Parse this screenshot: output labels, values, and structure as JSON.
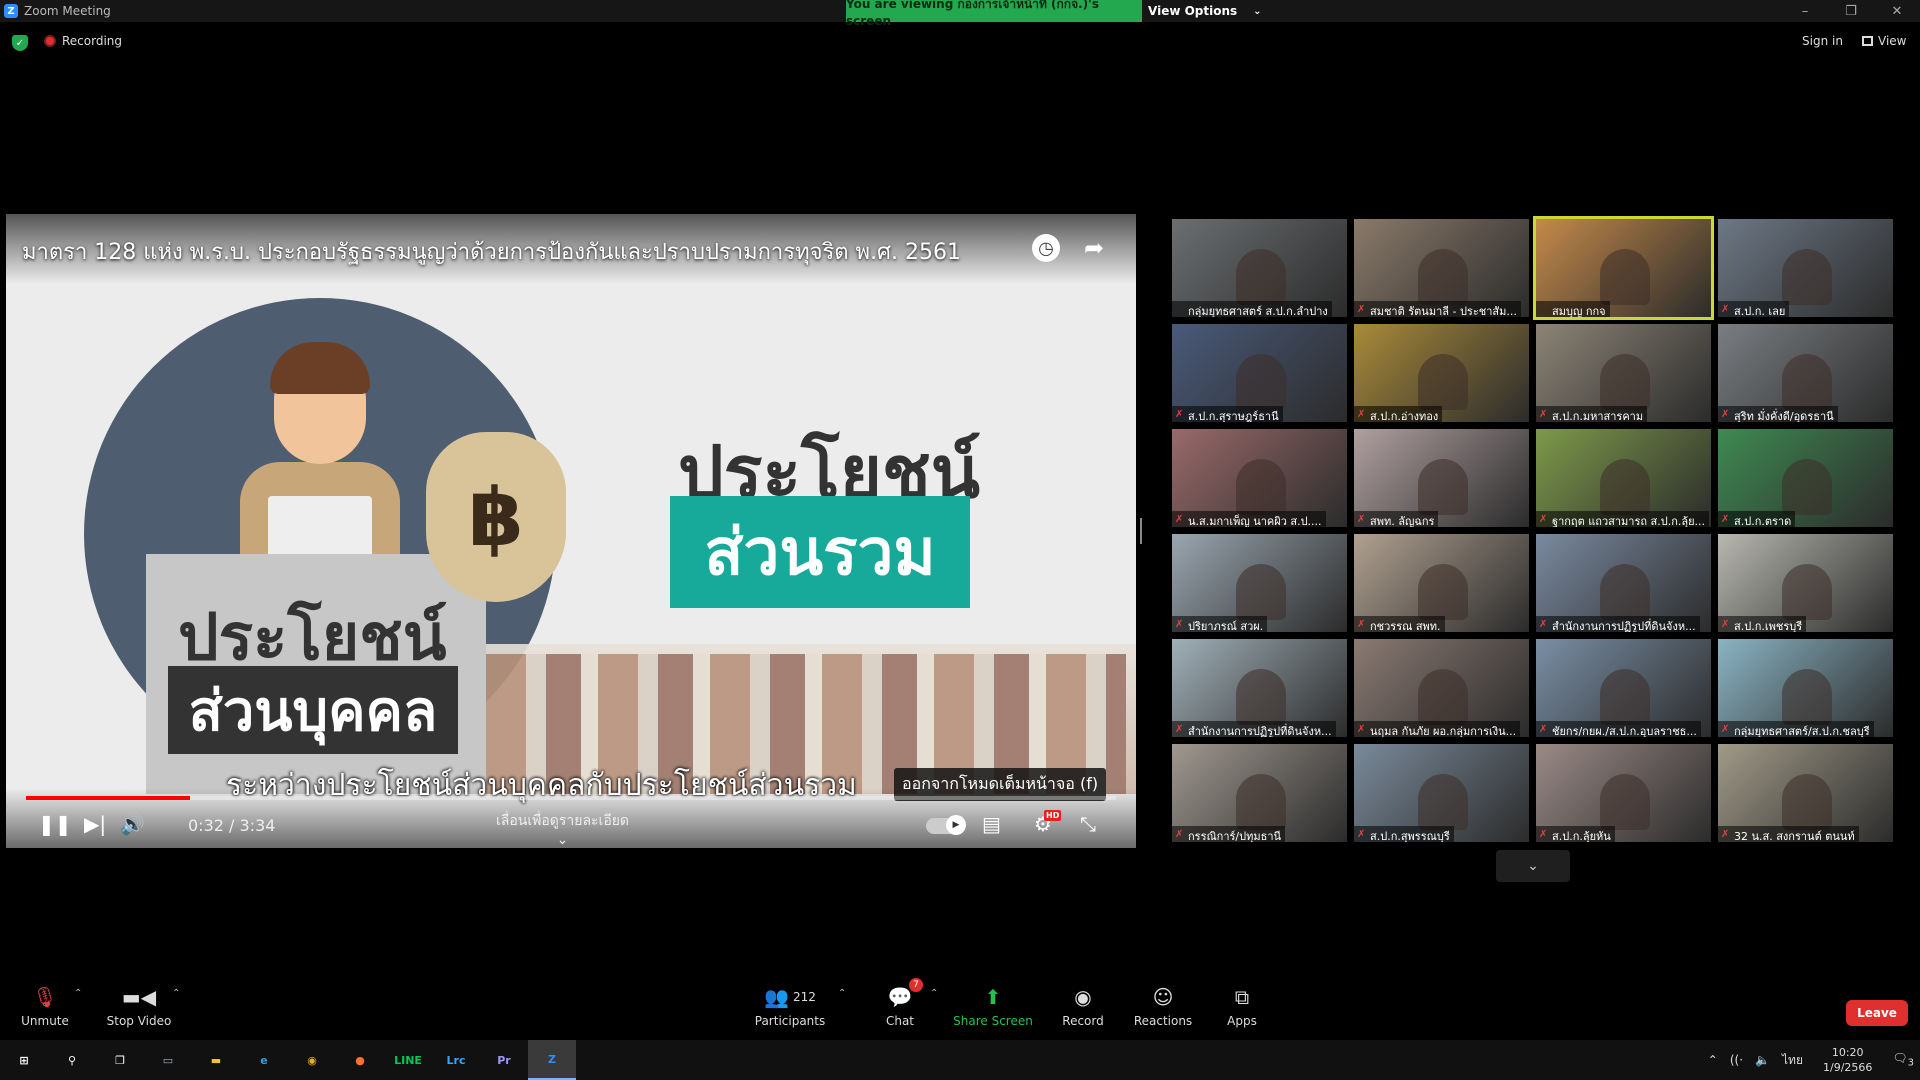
{
  "window": {
    "title": "Zoom Meeting",
    "viewing_banner": "You are viewing กองการเจ้าหน้าที่ (กกจ.)'s screen",
    "view_options": "View Options"
  },
  "meeting_bar": {
    "recording": "Recording",
    "sign_in": "Sign in",
    "view": "View"
  },
  "shared_video": {
    "title": "มาตรา 128 แห่ง พ.ร.บ. ประกอบรัฐธรรมนูญว่าด้วยการป้องกันและปราบปรามการทุจริต พ.ศ. 2561",
    "private_label_top": "ประโยชน์",
    "private_label_bottom": "ส่วนบุคคล",
    "public_label_top": "ประโยชน์",
    "public_label_bottom": "ส่วนรวม",
    "currency_symbol": "฿",
    "subtitle": "ระหว่างประโยชน์ส่วนบุคคลกับประโยชน์ส่วนรวม",
    "exit_fullscreen": "ออกจากโหมดเต็มหน้าจอ (f)",
    "time": "0:32 / 3:34",
    "progress_fraction": 0.15,
    "swipe_hint": "เลื่อนเพื่อดูรายละเอียด",
    "hd": "HD"
  },
  "gallery": [
    {
      "name": "กลุ่มยุทธศาสตร์ ส.ป.ก.ลำปาง",
      "bg": "#6b6f72",
      "muted": false,
      "active": false
    },
    {
      "name": "สมชาติ รัตนมาลี - ประชาสัม...",
      "bg": "#8a7a6a",
      "muted": true,
      "active": false
    },
    {
      "name": "สมบุญ กกจ",
      "bg": "#c48a4a",
      "muted": false,
      "active": true
    },
    {
      "name": "ส.ป.ก. เลย",
      "bg": "#6d7886",
      "muted": true,
      "active": false
    },
    {
      "name": "ส.ป.ก.สุราษฎร์ธานี",
      "bg": "#4a5a7a",
      "muted": true,
      "active": false
    },
    {
      "name": "ส.ป.ก.อ่างทอง",
      "bg": "#a88a3a",
      "muted": true,
      "active": false
    },
    {
      "name": "ส.ป.ก.มหาสารคาม",
      "bg": "#8c8476",
      "muted": true,
      "active": false
    },
    {
      "name": "สุริท มั่งคั่งดี/อุดรธานี",
      "bg": "#7a7e82",
      "muted": true,
      "active": false
    },
    {
      "name": "น.ส.มกาเพ็ญ นาคผิว ส.ป....",
      "bg": "#9a6a6a",
      "muted": true,
      "active": false
    },
    {
      "name": "สพท. ลัญฉกร",
      "bg": "#b0a0a0",
      "muted": true,
      "active": false
    },
    {
      "name": "ฐากฤต แถวสามารถ ส.ป.ก.ลุ้ย...",
      "bg": "#7d9a4a",
      "muted": true,
      "active": false
    },
    {
      "name": "ส.ป.ก.ตราด",
      "bg": "#3f8a52",
      "muted": true,
      "active": false
    },
    {
      "name": "ปริยาภรณ์ สวผ.",
      "bg": "#9aa6b0",
      "muted": true,
      "active": false
    },
    {
      "name": "กชวรรณ สพท.",
      "bg": "#b0a090",
      "muted": true,
      "active": false
    },
    {
      "name": "สำนักงานการปฏิรูปที่ดินจังห...",
      "bg": "#7a8aa0",
      "muted": true,
      "active": false
    },
    {
      "name": "ส.ป.ก.เพชรบุรี",
      "bg": "#b8b8b0",
      "muted": true,
      "active": false
    },
    {
      "name": "สำนักงานการปฏิรูปที่ดินจังห...",
      "bg": "#a0b0b8",
      "muted": true,
      "active": false
    },
    {
      "name": "นฤมล กันภัย ผอ.กลุ่มการเงิน...",
      "bg": "#8a7a72",
      "muted": true,
      "active": false
    },
    {
      "name": "ชัยกร/กยผ./ส.ป.ก.อุบลราชธ...",
      "bg": "#7a8fa6",
      "muted": true,
      "active": false
    },
    {
      "name": "กลุ่มยุทธศาสตร์/ส.ป.ก.ชลบุรี",
      "bg": "#8ab4c4",
      "muted": true,
      "active": false
    },
    {
      "name": "กรรณิการ์/ปทุมธานี",
      "bg": "#a09890",
      "muted": true,
      "active": false
    },
    {
      "name": "ส.ป.ก.สุพรรณบุรี",
      "bg": "#7a8a9a",
      "muted": true,
      "active": false
    },
    {
      "name": "ส.ป.ก.ลุ้ยหัน",
      "bg": "#9a8a86",
      "muted": true,
      "active": false
    },
    {
      "name": "32 น.ส. สงกรานต์ ตนนท์",
      "bg": "#a09a88",
      "muted": true,
      "active": false
    }
  ],
  "controls": {
    "unmute": "Unmute",
    "stop_video": "Stop Video",
    "participants": "Participants",
    "participants_count": "212",
    "chat": "Chat",
    "chat_badge": "7",
    "share_screen": "Share Screen",
    "record": "Record",
    "reactions": "Reactions",
    "apps": "Apps",
    "leave": "Leave"
  },
  "taskbar": {
    "apps": [
      {
        "name": "start",
        "glyph": "⊞",
        "color": "#fff"
      },
      {
        "name": "search",
        "glyph": "⚲",
        "color": "#fff"
      },
      {
        "name": "task-view",
        "glyph": "❐",
        "color": "#fff"
      },
      {
        "name": "tablet",
        "glyph": "▭",
        "color": "#9bc"
      },
      {
        "name": "explorer",
        "glyph": "▬",
        "color": "#f0c040"
      },
      {
        "name": "edge",
        "glyph": "e",
        "color": "#33a0e0"
      },
      {
        "name": "chrome",
        "glyph": "◉",
        "color": "#e8b020"
      },
      {
        "name": "firefox",
        "glyph": "●",
        "color": "#ff7030"
      },
      {
        "name": "line",
        "glyph": "LINE",
        "color": "#06c755"
      },
      {
        "name": "lightroom",
        "glyph": "Lrc",
        "color": "#31a8ff"
      },
      {
        "name": "premiere",
        "glyph": "Pr",
        "color": "#9999ff"
      },
      {
        "name": "zoom",
        "glyph": "Z",
        "color": "#2d8cff"
      }
    ],
    "lang": "ไทย",
    "time": "10:20",
    "date": "1/9/2566",
    "notif_count": "3"
  }
}
